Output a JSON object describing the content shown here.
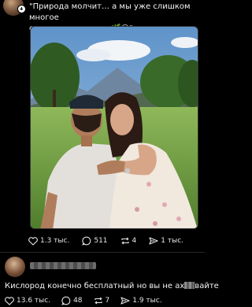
{
  "post": {
    "caption_line1": "\"Природа молчит… а мы уже слишком многое",
    "caption_line2": "сказали взглядами 🌿😉\"",
    "actions": {
      "likes": "1.3 тыс.",
      "comments": "511",
      "reposts": "4",
      "shares": "1 тыс."
    }
  },
  "reply": {
    "text_before": "Кислород конечно бесплатный но вы не ах",
    "text_after": "вайте",
    "actions": {
      "likes": "13.6 тыс.",
      "comments": "48",
      "reposts": "7",
      "shares": "1.9 тыс."
    }
  },
  "icons": {
    "like": "heart-icon",
    "comment": "comment-bubble-icon",
    "repost": "repost-icon",
    "share": "send-icon"
  }
}
